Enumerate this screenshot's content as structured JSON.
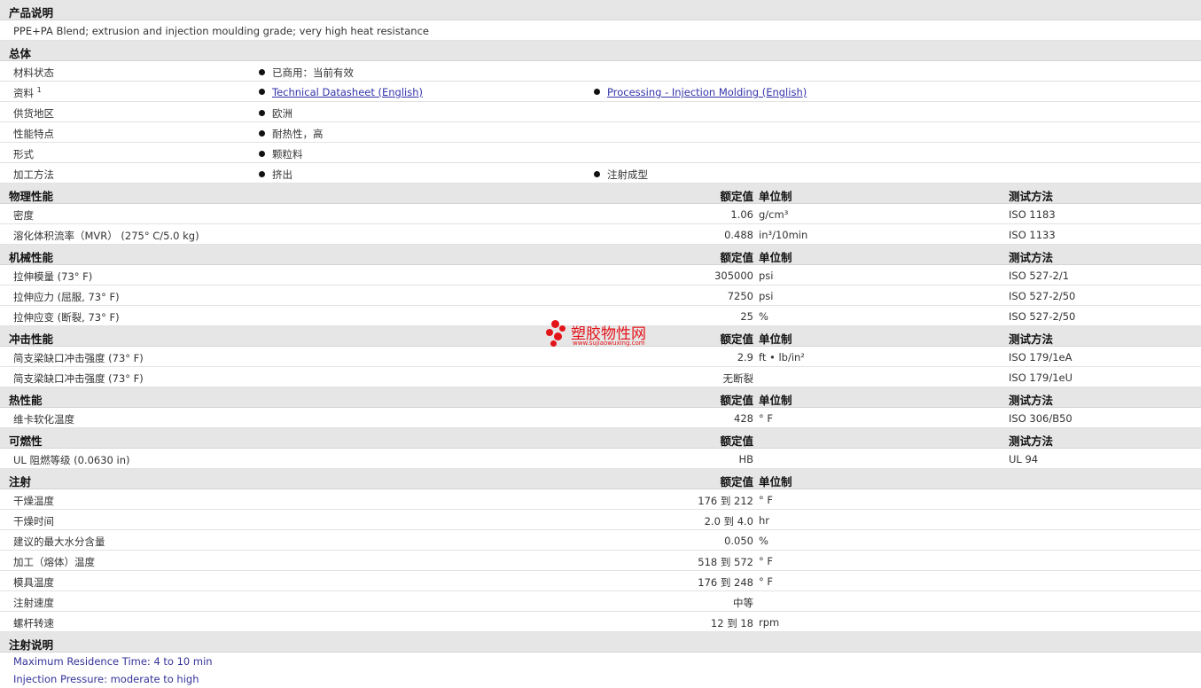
{
  "sections": {
    "desc": {
      "title": "产品说明",
      "text": "PPE+PA Blend; extrusion and injection moulding grade; very high heat resistance"
    },
    "general": {
      "title": "总体",
      "rows": [
        {
          "label": "材料状态",
          "v1": "已商用：当前有效",
          "v2": ""
        },
        {
          "label": "资料",
          "sup": "1",
          "v1": "Technical Datasheet (English)",
          "v2": "Processing - Injection Molding (English)"
        },
        {
          "label": "供货地区",
          "v1": "欧洲",
          "v2": ""
        },
        {
          "label": "性能特点",
          "v1": "耐热性，高",
          "v2": ""
        },
        {
          "label": "形式",
          "v1": "颗粒料",
          "v2": ""
        },
        {
          "label": "加工方法",
          "v1": "挤出",
          "v2": "注射成型"
        }
      ]
    },
    "physical": {
      "title": "物理性能",
      "h_value": "额定值",
      "h_unit": "单位制",
      "h_method": "测试方法",
      "rows": [
        {
          "label": "密度",
          "value": "1.06",
          "unit": "g/cm³",
          "method": "ISO 1183"
        },
        {
          "label": "溶化体积流率（MVR） (275° C/5.0 kg)",
          "value": "0.488",
          "unit": "in³/10min",
          "method": "ISO 1133"
        }
      ]
    },
    "mechanical": {
      "title": "机械性能",
      "h_value": "额定值",
      "h_unit": "单位制",
      "h_method": "测试方法",
      "rows": [
        {
          "label": "拉伸模量 (73° F)",
          "value": "305000",
          "unit": "psi",
          "method": "ISO 527-2/1"
        },
        {
          "label": "拉伸应力 (屈服, 73° F)",
          "value": "7250",
          "unit": "psi",
          "method": "ISO 527-2/50"
        },
        {
          "label": "拉伸应变 (断裂, 73° F)",
          "value": "25",
          "unit": "%",
          "method": "ISO 527-2/50"
        }
      ]
    },
    "impact": {
      "title": "冲击性能",
      "h_value": "额定值",
      "h_unit": "单位制",
      "h_method": "测试方法",
      "rows": [
        {
          "label": "简支梁缺口冲击强度 (73° F)",
          "value": "2.9",
          "unit": "ft • lb/in²",
          "method": "ISO 179/1eA"
        },
        {
          "label": "简支梁缺口冲击强度 (73° F)",
          "value": "无断裂",
          "unit": "",
          "method": "ISO 179/1eU"
        }
      ]
    },
    "thermal": {
      "title": "热性能",
      "h_value": "额定值",
      "h_unit": "单位制",
      "h_method": "测试方法",
      "rows": [
        {
          "label": "维卡软化温度",
          "value": "428",
          "unit": "° F",
          "method": "ISO 306/B50"
        }
      ]
    },
    "flammability": {
      "title": "可燃性",
      "h_value": "额定值",
      "h_unit": "",
      "h_method": "测试方法",
      "rows": [
        {
          "label": "UL 阻燃等级 (0.0630 in)",
          "value": "HB",
          "unit": "",
          "method": "UL 94"
        }
      ]
    },
    "injection": {
      "title": "注射",
      "h_value": "额定值",
      "h_unit": "单位制",
      "h_method": "",
      "rows": [
        {
          "label": "干燥温度",
          "value": "176 到  212",
          "unit": "° F",
          "method": ""
        },
        {
          "label": "干燥时间",
          "value": "2.0 到  4.0",
          "unit": "hr",
          "method": ""
        },
        {
          "label": "建议的最大水分含量",
          "value": "0.050",
          "unit": "%",
          "method": ""
        },
        {
          "label": "加工（熔体）温度",
          "value": "518 到  572",
          "unit": "° F",
          "method": ""
        },
        {
          "label": "模具温度",
          "value": "176 到  248",
          "unit": "° F",
          "method": ""
        },
        {
          "label": "注射速度",
          "value": "中等",
          "unit": "",
          "method": ""
        },
        {
          "label": "螺杆转速",
          "value": "12 到  18",
          "unit": "rpm",
          "method": ""
        }
      ]
    },
    "notes": {
      "title": "注射说明",
      "lines": [
        "Maximum Residence Time: 4 to 10 min",
        "Injection Pressure: moderate to high"
      ]
    }
  },
  "watermark": {
    "name": "塑胶物性网",
    "url": "www.sujiaowuxing.com",
    "color": "#e4141b"
  }
}
